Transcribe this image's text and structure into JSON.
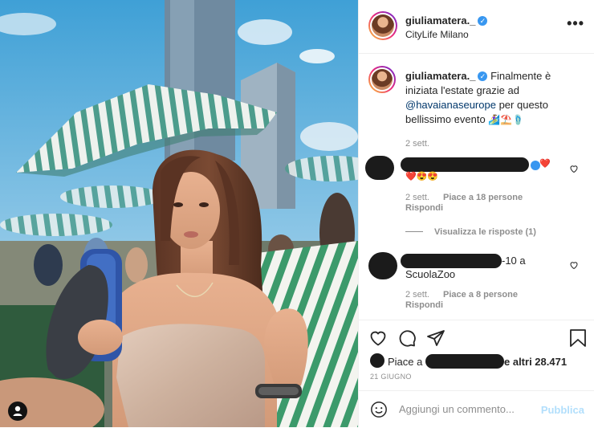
{
  "post": {
    "username": "giuliamatera._",
    "location": "CityLife Milano"
  },
  "caption": {
    "username": "giuliamatera._",
    "text_before": "Finalmente è iniziata l'estate grazie ad",
    "mention": "@havaianaseurope",
    "text_after": "per questo bellissimo evento",
    "emojis": "🏄‍♀️⛱️🩴",
    "time": "2 sett."
  },
  "comments": [
    {
      "emojis_line1": "❤️",
      "emojis_line2": "❤️😍😍",
      "time": "2 sett.",
      "likes": "Piace a 18 persone",
      "reply": "Rispondi"
    },
    {
      "text_suffix": "-10 a",
      "text_line2": "ScuolaZoo",
      "time": "2 sett.",
      "likes": "Piace a 8 persone",
      "reply": "Rispondi"
    }
  ],
  "view_replies": "Visualizza le risposte (1)",
  "likes": {
    "prefix": "Piace a",
    "suffix": "e altri 28.471"
  },
  "date": "21 GIUGNO",
  "add_comment": {
    "placeholder": "Aggiungi un commento...",
    "publish": "Pubblica"
  },
  "icons": {
    "more": "more-options-icon",
    "like": "heart-icon",
    "comment": "comment-icon",
    "share": "share-icon",
    "save": "bookmark-icon",
    "emoji": "emoji-icon",
    "tagged": "user-tag-icon"
  },
  "colors": {
    "verified": "#3897f0",
    "mention": "#00376b",
    "publish_disabled": "#b2dffc",
    "meta": "#8e8e8e"
  }
}
